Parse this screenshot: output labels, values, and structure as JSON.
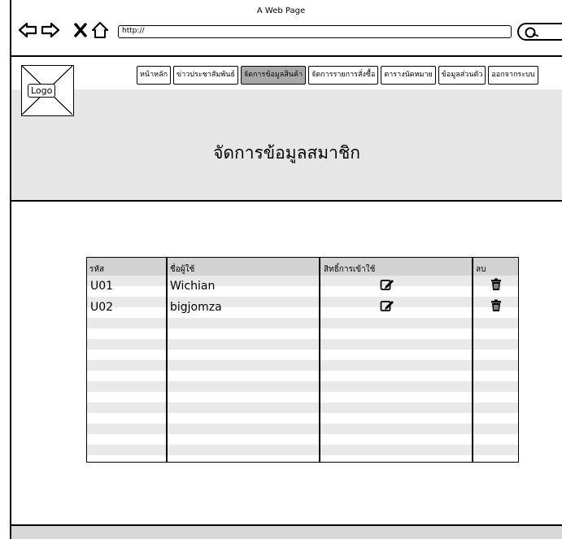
{
  "browser": {
    "title": "A Web Page",
    "url": "http://"
  },
  "header": {
    "logo_label": "Logo",
    "menu": [
      {
        "label": "หน้าหลัก",
        "active": false
      },
      {
        "label": "ข่าวประชาสัมพันธ์",
        "active": false
      },
      {
        "label": "จัดการข้อมูลสินค้า",
        "active": true
      },
      {
        "label": "จัดการรายการสั่งซื้อ",
        "active": false
      },
      {
        "label": "ตารางนัดหมาย",
        "active": false
      },
      {
        "label": "ข้อมูลส่วนตัว",
        "active": false
      },
      {
        "label": "ออกจากระบบ",
        "active": false
      }
    ],
    "page_title": "จัดการข้อมูลสมาชิก"
  },
  "table": {
    "columns": [
      "รหัส",
      "ชื่อผู้ใช้",
      "สิทธิ์การเข้าใช้",
      "ลบ"
    ],
    "rows": [
      {
        "id": "U01",
        "username": "Wichian",
        "edit_icon": "edit-icon",
        "delete_icon": "trash-icon"
      },
      {
        "id": "U02",
        "username": "bigjomza",
        "edit_icon": "edit-icon",
        "delete_icon": "trash-icon"
      }
    ],
    "empty_rows": 7
  },
  "colors": {
    "header_band": "#e6e6e6",
    "active_menu": "#a8a8a8",
    "table_header": "#d2d2d2",
    "row_alt": "#e9e9e9"
  }
}
